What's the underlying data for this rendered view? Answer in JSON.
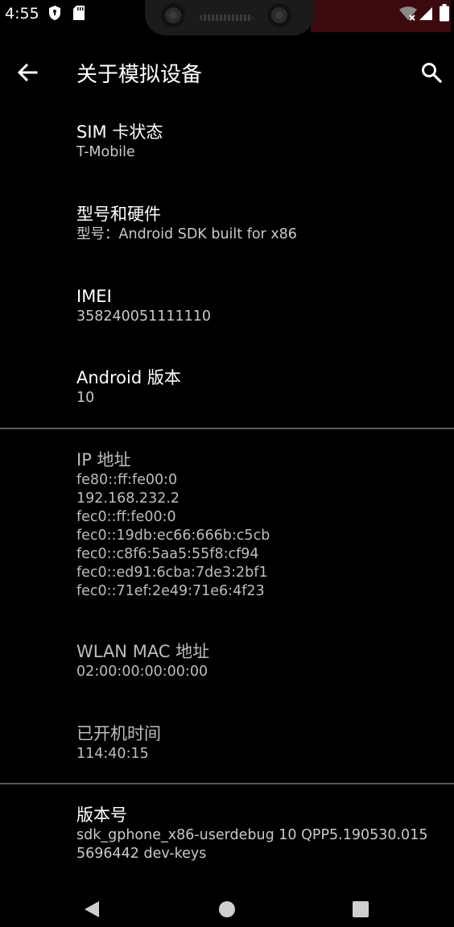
{
  "status_bar": {
    "time": "4:55",
    "icons": [
      "shield-icon",
      "sd-card-icon",
      "wifi-off-icon",
      "signal-icon",
      "battery-icon"
    ]
  },
  "app_bar": {
    "title": "关于模拟设备",
    "back_icon": "arrow-back-icon",
    "search_icon": "search-icon"
  },
  "items": [
    {
      "title": "SIM 卡状态",
      "lines": [
        "T-Mobile"
      ]
    },
    {
      "title": "型号和硬件",
      "lines": [
        "型号：Android SDK built for x86"
      ]
    },
    {
      "title": "IMEI",
      "lines": [
        "358240051111110"
      ]
    },
    {
      "title": "Android 版本",
      "lines": [
        "10"
      ]
    },
    {
      "title": "IP 地址",
      "lines": [
        "fe80::ff:fe00:0",
        "192.168.232.2",
        "fec0::ff:fe00:0",
        "fec0::19db:ec66:666b:c5cb",
        "fec0::c8f6:5aa5:55f8:cf94",
        "fec0::ed91:6cba:7de3:2bf1",
        "fec0::71ef:2e49:71e6:4f23"
      ]
    },
    {
      "title": "WLAN MAC 地址",
      "lines": [
        "02:00:00:00:00:00"
      ]
    },
    {
      "title": "已开机时间",
      "lines": [
        "114:40:15"
      ]
    },
    {
      "title": "版本号",
      "lines": [
        "sdk_gphone_x86-userdebug 10 QPP5.190530.015",
        "5696442 dev-keys"
      ]
    }
  ],
  "nav_bar": {
    "icons": [
      "back-triangle-icon",
      "home-circle-icon",
      "recents-square-icon"
    ]
  },
  "colors": {
    "background": "#000000",
    "text_primary": "#ffffff",
    "text_secondary": "#c9c9c9",
    "divider": "#5a5a5a"
  }
}
